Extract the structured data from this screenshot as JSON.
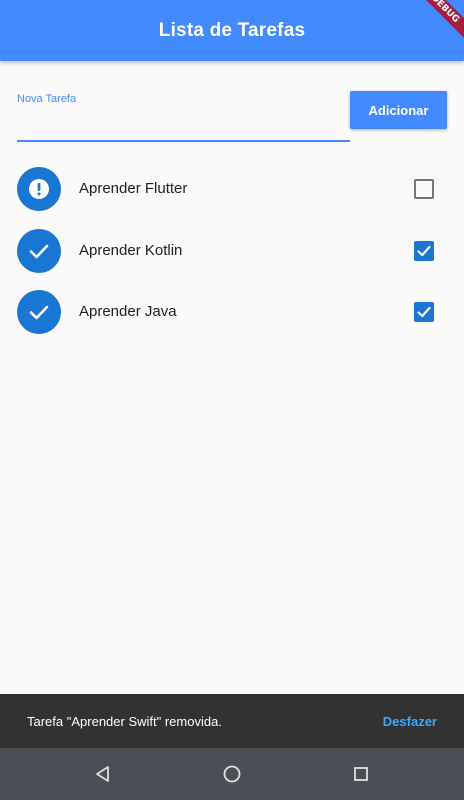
{
  "app_bar": {
    "title": "Lista de Tarefas",
    "debug_banner": "DEBUG"
  },
  "form": {
    "label": "Nova Tarefa",
    "value": "",
    "button_label": "Adicionar"
  },
  "tasks": [
    {
      "title": "Aprender Flutter",
      "done": false,
      "status_icon": "exclamation-icon"
    },
    {
      "title": "Aprender Kotlin",
      "done": true,
      "status_icon": "check-icon"
    },
    {
      "title": "Aprender Java",
      "done": true,
      "status_icon": "check-icon"
    }
  ],
  "snackbar": {
    "message": "Tarefa \"Aprender Swift\" removida.",
    "action": "Desfazer"
  },
  "nav_bar": {
    "icons": [
      "back-triangle-icon",
      "home-circle-icon",
      "recents-square-icon"
    ]
  },
  "colors": {
    "primary": "#448aff",
    "avatar": "#1976d2",
    "checkbox": "#1976d2",
    "snackbar_bg": "#323232",
    "snackbar_action": "#40a8f5",
    "nav_bg": "#4b4f55"
  }
}
